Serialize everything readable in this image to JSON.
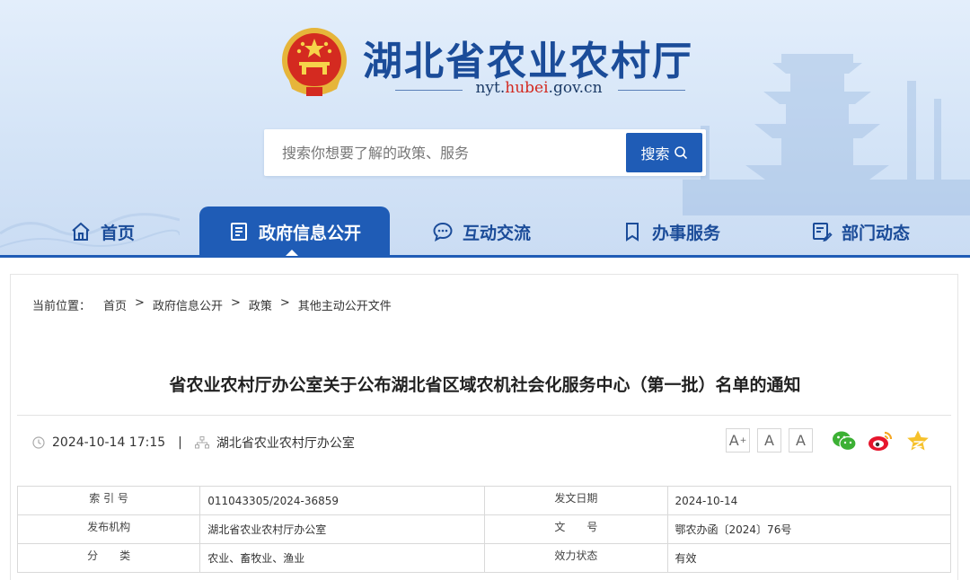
{
  "site": {
    "title": "湖北省农业农村厅",
    "domain_prefix": "nyt.",
    "domain_highlight": "hubei",
    "domain_suffix": ".gov.cn"
  },
  "search": {
    "placeholder": "搜索你想要了解的政策、服务",
    "button_label": "搜索"
  },
  "nav": {
    "items": [
      {
        "label": "首页",
        "icon": "home-icon"
      },
      {
        "label": "政府信息公开",
        "icon": "document-list-icon",
        "active": true
      },
      {
        "label": "互动交流",
        "icon": "chat-bubble-icon"
      },
      {
        "label": "办事服务",
        "icon": "bookmark-icon"
      },
      {
        "label": "部门动态",
        "icon": "news-edit-icon"
      }
    ]
  },
  "breadcrumb": {
    "lead": "当前位置：",
    "items": [
      "首页",
      "政府信息公开",
      "政策",
      "其他主动公开文件"
    ],
    "separator": ">"
  },
  "article": {
    "title": "省农业农村厅办公室关于公布湖北省区域农机社会化服务中心（第一批）名单的通知",
    "datetime": "2024-10-14 17:15",
    "meta_separator": "|",
    "publisher": "湖北省农业农村厅办公室"
  },
  "font_size_buttons": [
    "A",
    "A",
    "A"
  ],
  "font_size_plus_mark": "+",
  "share": [
    "wechat-icon",
    "weibo-icon",
    "favorite-star-icon"
  ],
  "info_table": [
    {
      "k1": "索 引 号",
      "v1": "011043305/2024-36859",
      "k2": "发文日期",
      "v2": "2024-10-14"
    },
    {
      "k1": "发布机构",
      "v1": "湖北省农业农村厅办公室",
      "k2": "文　　号",
      "v2": "鄂农办函〔2024〕76号"
    },
    {
      "k1": "分　　类",
      "v1": "农业、畜牧业、渔业",
      "k2": "效力状态",
      "v2": "有效"
    }
  ],
  "colors": {
    "brand_blue": "#1f5cb6",
    "title_blue": "#1b4c99",
    "domain_red": "#d3281f",
    "header_bg": "#d4e4f7"
  }
}
